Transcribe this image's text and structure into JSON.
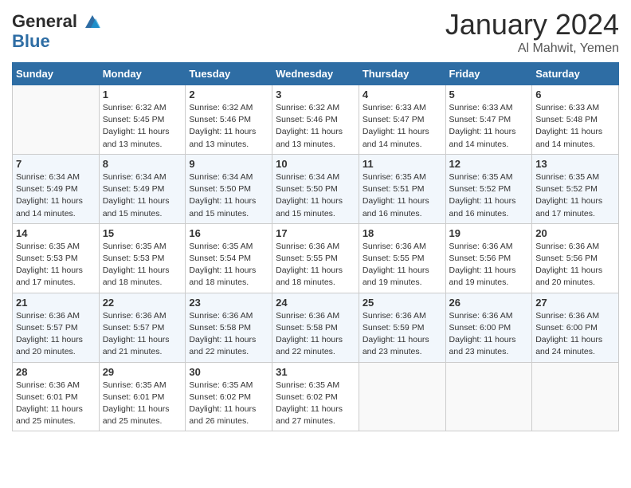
{
  "header": {
    "logo_line1": "General",
    "logo_line2": "Blue",
    "month": "January 2024",
    "location": "Al Mahwit, Yemen"
  },
  "columns": [
    "Sunday",
    "Monday",
    "Tuesday",
    "Wednesday",
    "Thursday",
    "Friday",
    "Saturday"
  ],
  "weeks": [
    [
      {
        "day": "",
        "info": ""
      },
      {
        "day": "1",
        "info": "Sunrise: 6:32 AM\nSunset: 5:45 PM\nDaylight: 11 hours\nand 13 minutes."
      },
      {
        "day": "2",
        "info": "Sunrise: 6:32 AM\nSunset: 5:46 PM\nDaylight: 11 hours\nand 13 minutes."
      },
      {
        "day": "3",
        "info": "Sunrise: 6:32 AM\nSunset: 5:46 PM\nDaylight: 11 hours\nand 13 minutes."
      },
      {
        "day": "4",
        "info": "Sunrise: 6:33 AM\nSunset: 5:47 PM\nDaylight: 11 hours\nand 14 minutes."
      },
      {
        "day": "5",
        "info": "Sunrise: 6:33 AM\nSunset: 5:47 PM\nDaylight: 11 hours\nand 14 minutes."
      },
      {
        "day": "6",
        "info": "Sunrise: 6:33 AM\nSunset: 5:48 PM\nDaylight: 11 hours\nand 14 minutes."
      }
    ],
    [
      {
        "day": "7",
        "info": "Sunrise: 6:34 AM\nSunset: 5:49 PM\nDaylight: 11 hours\nand 14 minutes."
      },
      {
        "day": "8",
        "info": "Sunrise: 6:34 AM\nSunset: 5:49 PM\nDaylight: 11 hours\nand 15 minutes."
      },
      {
        "day": "9",
        "info": "Sunrise: 6:34 AM\nSunset: 5:50 PM\nDaylight: 11 hours\nand 15 minutes."
      },
      {
        "day": "10",
        "info": "Sunrise: 6:34 AM\nSunset: 5:50 PM\nDaylight: 11 hours\nand 15 minutes."
      },
      {
        "day": "11",
        "info": "Sunrise: 6:35 AM\nSunset: 5:51 PM\nDaylight: 11 hours\nand 16 minutes."
      },
      {
        "day": "12",
        "info": "Sunrise: 6:35 AM\nSunset: 5:52 PM\nDaylight: 11 hours\nand 16 minutes."
      },
      {
        "day": "13",
        "info": "Sunrise: 6:35 AM\nSunset: 5:52 PM\nDaylight: 11 hours\nand 17 minutes."
      }
    ],
    [
      {
        "day": "14",
        "info": "Sunrise: 6:35 AM\nSunset: 5:53 PM\nDaylight: 11 hours\nand 17 minutes."
      },
      {
        "day": "15",
        "info": "Sunrise: 6:35 AM\nSunset: 5:53 PM\nDaylight: 11 hours\nand 18 minutes."
      },
      {
        "day": "16",
        "info": "Sunrise: 6:35 AM\nSunset: 5:54 PM\nDaylight: 11 hours\nand 18 minutes."
      },
      {
        "day": "17",
        "info": "Sunrise: 6:36 AM\nSunset: 5:55 PM\nDaylight: 11 hours\nand 18 minutes."
      },
      {
        "day": "18",
        "info": "Sunrise: 6:36 AM\nSunset: 5:55 PM\nDaylight: 11 hours\nand 19 minutes."
      },
      {
        "day": "19",
        "info": "Sunrise: 6:36 AM\nSunset: 5:56 PM\nDaylight: 11 hours\nand 19 minutes."
      },
      {
        "day": "20",
        "info": "Sunrise: 6:36 AM\nSunset: 5:56 PM\nDaylight: 11 hours\nand 20 minutes."
      }
    ],
    [
      {
        "day": "21",
        "info": "Sunrise: 6:36 AM\nSunset: 5:57 PM\nDaylight: 11 hours\nand 20 minutes."
      },
      {
        "day": "22",
        "info": "Sunrise: 6:36 AM\nSunset: 5:57 PM\nDaylight: 11 hours\nand 21 minutes."
      },
      {
        "day": "23",
        "info": "Sunrise: 6:36 AM\nSunset: 5:58 PM\nDaylight: 11 hours\nand 22 minutes."
      },
      {
        "day": "24",
        "info": "Sunrise: 6:36 AM\nSunset: 5:58 PM\nDaylight: 11 hours\nand 22 minutes."
      },
      {
        "day": "25",
        "info": "Sunrise: 6:36 AM\nSunset: 5:59 PM\nDaylight: 11 hours\nand 23 minutes."
      },
      {
        "day": "26",
        "info": "Sunrise: 6:36 AM\nSunset: 6:00 PM\nDaylight: 11 hours\nand 23 minutes."
      },
      {
        "day": "27",
        "info": "Sunrise: 6:36 AM\nSunset: 6:00 PM\nDaylight: 11 hours\nand 24 minutes."
      }
    ],
    [
      {
        "day": "28",
        "info": "Sunrise: 6:36 AM\nSunset: 6:01 PM\nDaylight: 11 hours\nand 25 minutes."
      },
      {
        "day": "29",
        "info": "Sunrise: 6:35 AM\nSunset: 6:01 PM\nDaylight: 11 hours\nand 25 minutes."
      },
      {
        "day": "30",
        "info": "Sunrise: 6:35 AM\nSunset: 6:02 PM\nDaylight: 11 hours\nand 26 minutes."
      },
      {
        "day": "31",
        "info": "Sunrise: 6:35 AM\nSunset: 6:02 PM\nDaylight: 11 hours\nand 27 minutes."
      },
      {
        "day": "",
        "info": ""
      },
      {
        "day": "",
        "info": ""
      },
      {
        "day": "",
        "info": ""
      }
    ]
  ]
}
